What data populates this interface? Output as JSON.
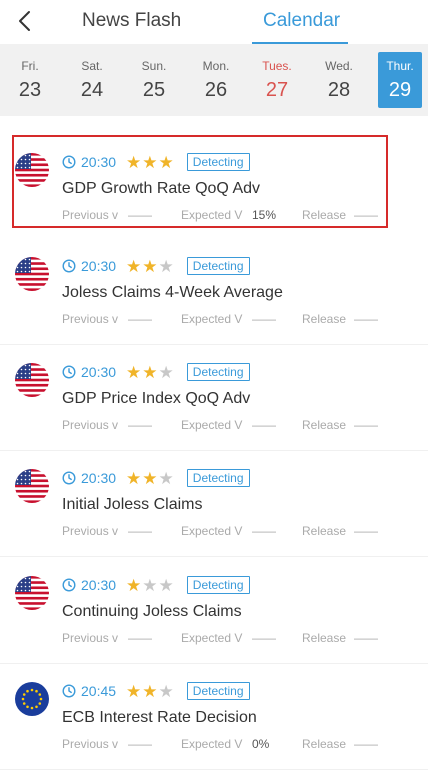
{
  "header": {
    "back_icon": "chevron-left-icon",
    "tabs": [
      {
        "label": "News Flash",
        "active": false
      },
      {
        "label": "Calendar",
        "active": true
      }
    ],
    "accent_color": "#3a9ad9"
  },
  "days": [
    {
      "name": "Fri.",
      "num": "23",
      "state": "normal"
    },
    {
      "name": "Sat.",
      "num": "24",
      "state": "normal"
    },
    {
      "name": "Sun.",
      "num": "25",
      "state": "normal"
    },
    {
      "name": "Mon.",
      "num": "26",
      "state": "normal"
    },
    {
      "name": "Tues.",
      "num": "27",
      "state": "holiday"
    },
    {
      "name": "Wed.",
      "num": "28",
      "state": "normal"
    },
    {
      "name": "Thur.",
      "num": "29",
      "state": "active"
    }
  ],
  "events": [
    {
      "flag": "us-flag-icon",
      "time": "20:30",
      "stars": 3,
      "badge": "Detecting",
      "title": "GDP Growth Rate QoQ Adv",
      "prev_label": "Previous v",
      "prev_val": "——",
      "exp_label": "Expected V",
      "exp_val": "15%",
      "rel_label": "Release",
      "rel_val": "——",
      "highlighted": true
    },
    {
      "flag": "us-flag-icon",
      "time": "20:30",
      "stars": 2,
      "badge": "Detecting",
      "title": "Joless Claims 4-Week Average",
      "prev_label": "Previous v",
      "prev_val": "——",
      "exp_label": "Expected V",
      "exp_val": "——",
      "rel_label": "Release",
      "rel_val": "——",
      "highlighted": false
    },
    {
      "flag": "us-flag-icon",
      "time": "20:30",
      "stars": 2,
      "badge": "Detecting",
      "title": "GDP Price Index QoQ Adv",
      "prev_label": "Previous v",
      "prev_val": "——",
      "exp_label": "Expected V",
      "exp_val": "——",
      "rel_label": "Release",
      "rel_val": "——",
      "highlighted": false
    },
    {
      "flag": "us-flag-icon",
      "time": "20:30",
      "stars": 2,
      "badge": "Detecting",
      "title": "Initial Joless Claims",
      "prev_label": "Previous v",
      "prev_val": "——",
      "exp_label": "Expected V",
      "exp_val": "——",
      "rel_label": "Release",
      "rel_val": "——",
      "highlighted": false
    },
    {
      "flag": "us-flag-icon",
      "time": "20:30",
      "stars": 1,
      "badge": "Detecting",
      "title": "Continuing Joless Claims",
      "prev_label": "Previous v",
      "prev_val": "——",
      "exp_label": "Expected V",
      "exp_val": "——",
      "rel_label": "Release",
      "rel_val": "——",
      "highlighted": false
    },
    {
      "flag": "eu-flag-icon",
      "time": "20:45",
      "stars": 2,
      "badge": "Detecting",
      "title": "ECB Interest Rate Decision",
      "prev_label": "Previous v",
      "prev_val": "——",
      "exp_label": "Expected V",
      "exp_val": "0%",
      "rel_label": "Release",
      "rel_val": "——",
      "highlighted": false
    }
  ]
}
